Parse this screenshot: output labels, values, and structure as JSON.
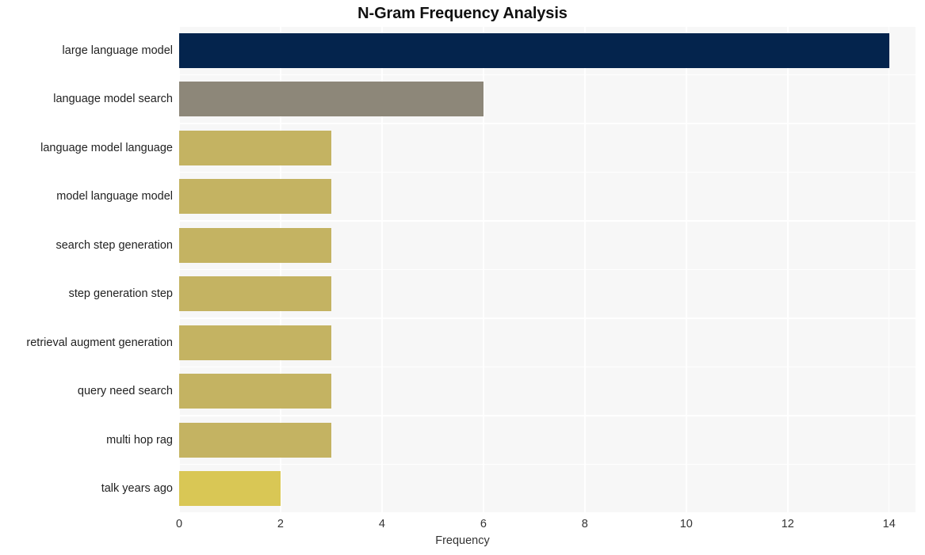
{
  "chart_data": {
    "type": "bar",
    "orientation": "horizontal",
    "title": "N-Gram Frequency Analysis",
    "xlabel": "Frequency",
    "ylabel": "",
    "xlim": [
      0,
      14.52
    ],
    "xticks": [
      0,
      2,
      4,
      6,
      8,
      10,
      12,
      14
    ],
    "grid": true,
    "legend": false,
    "categories": [
      "large language model",
      "language model search",
      "language model language",
      "model language model",
      "search step generation",
      "step generation step",
      "retrieval augment generation",
      "query need search",
      "multi hop rag",
      "talk years ago"
    ],
    "values": [
      14,
      6,
      3,
      3,
      3,
      3,
      3,
      3,
      3,
      2
    ],
    "bar_colors": [
      "#04244d",
      "#8d8779",
      "#c4b362",
      "#c4b362",
      "#c4b362",
      "#c4b362",
      "#c4b362",
      "#c4b362",
      "#c4b362",
      "#d9c755"
    ]
  },
  "style": {
    "plot_background": "#f7f7f7",
    "figure_background": "#ffffff",
    "grid_color": "#ffffff",
    "title_color": "#111111",
    "tick_color": "#333333"
  }
}
